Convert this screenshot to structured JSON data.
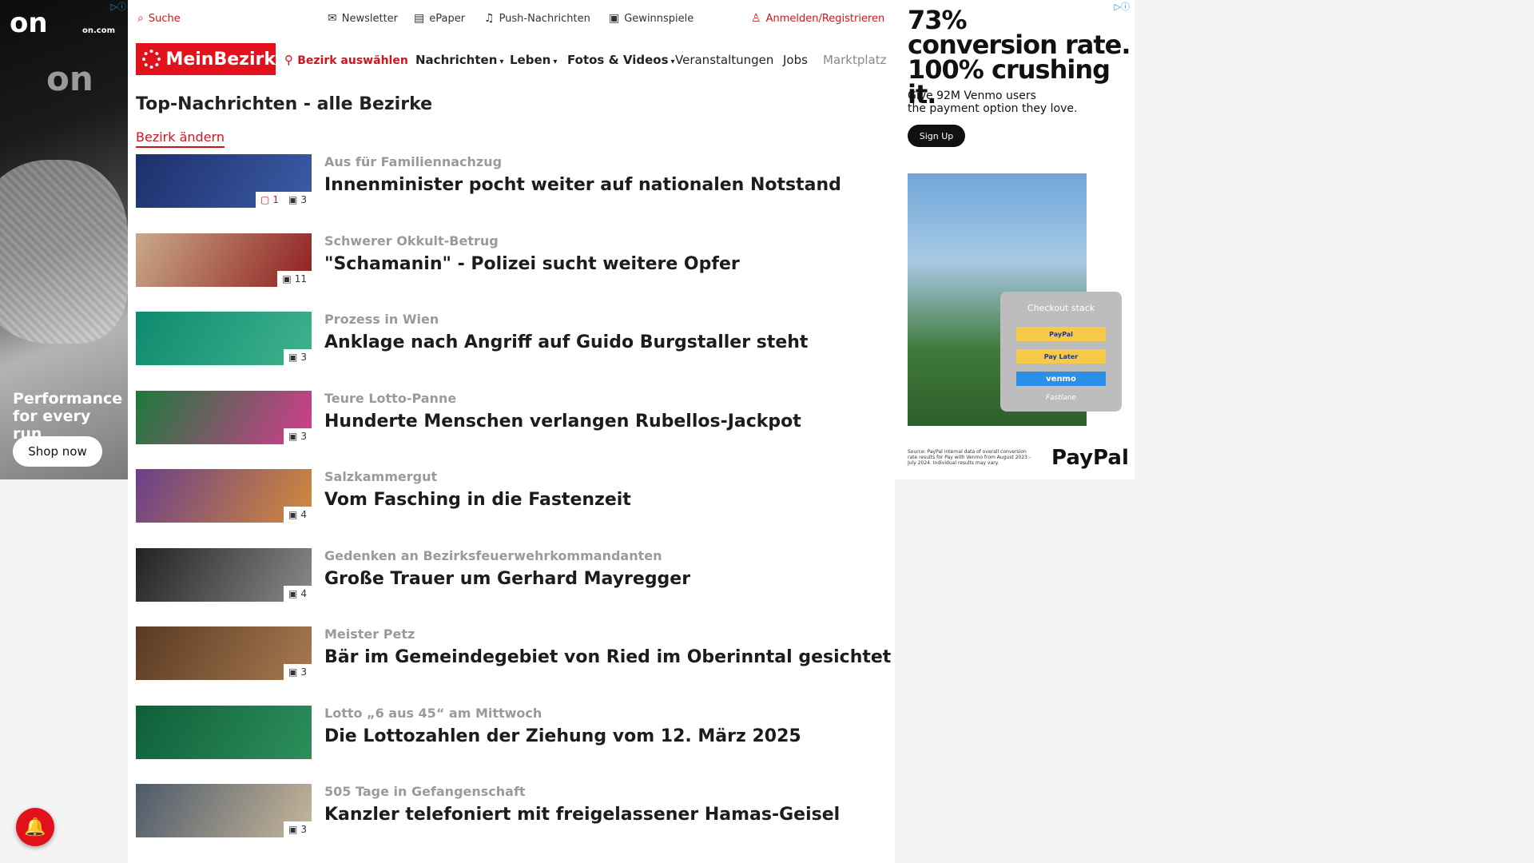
{
  "ad_left": {
    "logo": "on",
    "domain": "on.com",
    "tagline": "Performance for every run",
    "cta": "Shop now"
  },
  "topbar": {
    "search": "Suche",
    "newsletter": "Newsletter",
    "epaper": "ePaper",
    "push": "Push-Nachrichten",
    "games": "Gewinnspiele",
    "login": "Anmelden/Registrieren"
  },
  "nav": {
    "logo": "MeinBezirk",
    "select_district": "Bezirk auswählen",
    "items": [
      "Nachrichten",
      "Leben",
      "Fotos & Videos",
      "Veranstaltungen",
      "Jobs",
      "Marktplatz"
    ]
  },
  "main": {
    "title": "Top-Nachrichten - alle Bezirke",
    "change_district": "Bezirk ändern"
  },
  "articles": [
    {
      "kicker": "Aus für Familiennachzug",
      "headline": "Innenminister pocht weiter auf nationalen Notstand",
      "comments": "1",
      "photos": "3",
      "c1": "#1e2f6b",
      "c2": "#3a5ca8"
    },
    {
      "kicker": "Schwerer Okkult-Betrug",
      "headline": "\"Schamanin\" - Polizei sucht weitere Opfer",
      "comments": "",
      "photos": "11",
      "c1": "#c9a98a",
      "c2": "#8f1f1f"
    },
    {
      "kicker": "Prozess in Wien",
      "headline": "Anklage nach Angriff auf Guido Burgstaller steht",
      "comments": "",
      "photos": "3",
      "c1": "#0e8a6f",
      "c2": "#3fb38e"
    },
    {
      "kicker": "Teure Lotto-Panne",
      "headline": "Hunderte Menschen verlangen Rubellos-Jackpot",
      "comments": "",
      "photos": "3",
      "c1": "#1b7a3c",
      "c2": "#d63b8f"
    },
    {
      "kicker": "Salzkammergut",
      "headline": "Vom Fasching in die Fastenzeit",
      "comments": "",
      "photos": "4",
      "c1": "#6a3f8a",
      "c2": "#d38a3a"
    },
    {
      "kicker": "Gedenken an Bezirksfeuerwehrkommandanten",
      "headline": "Große Trauer um Gerhard Mayregger",
      "comments": "",
      "photos": "4",
      "c1": "#222222",
      "c2": "#8a8a8a"
    },
    {
      "kicker": "Meister Petz",
      "headline": "Bär im Gemeindegebiet von Ried im Oberinntal gesichtet",
      "comments": "",
      "photos": "3",
      "c1": "#5a3a22",
      "c2": "#a77a52"
    },
    {
      "kicker": "Lotto „6 aus 45“ am Mittwoch",
      "headline": "Die Lottozahlen der Ziehung vom 12. März 2025",
      "comments": "",
      "photos": "",
      "c1": "#0f5f3a",
      "c2": "#2d8f5a"
    },
    {
      "kicker": "505 Tage in Gefangenschaft",
      "headline": "Kanzler telefoniert mit freigelassener Hamas-Geisel",
      "comments": "",
      "photos": "3",
      "c1": "#4d5a6a",
      "c2": "#c8b79a"
    }
  ],
  "ad_right": {
    "headline_1": "73%",
    "headline_2": "conversion rate.",
    "headline_3": "100% crushing it.",
    "sub_1": "Give 92M Venmo users",
    "sub_2": "the payment option they love.",
    "cta": "Sign Up",
    "stack_title": "Checkout stack",
    "btn_paypal": "PayPal",
    "btn_paylater": "Pay Later",
    "btn_venmo": "venmo",
    "fastlane": "Fastlane",
    "fineprint": "Source: PayPal internal data of overall conversion rate results for Pay with Venmo from August 2023 - July 2024. Individual results may vary.",
    "brand": "PayPal"
  },
  "icons": {
    "search": "search-icon",
    "newsletter": "mail-icon",
    "epaper": "newspaper-icon",
    "push": "bell-icon",
    "games": "ticket-icon",
    "login": "user-icon",
    "location": "map-pin-icon",
    "comment": "comment-icon",
    "photo": "image-icon"
  },
  "colors": {
    "brand_red": "#e1121c",
    "kicker_grey": "#9a9a9a"
  }
}
